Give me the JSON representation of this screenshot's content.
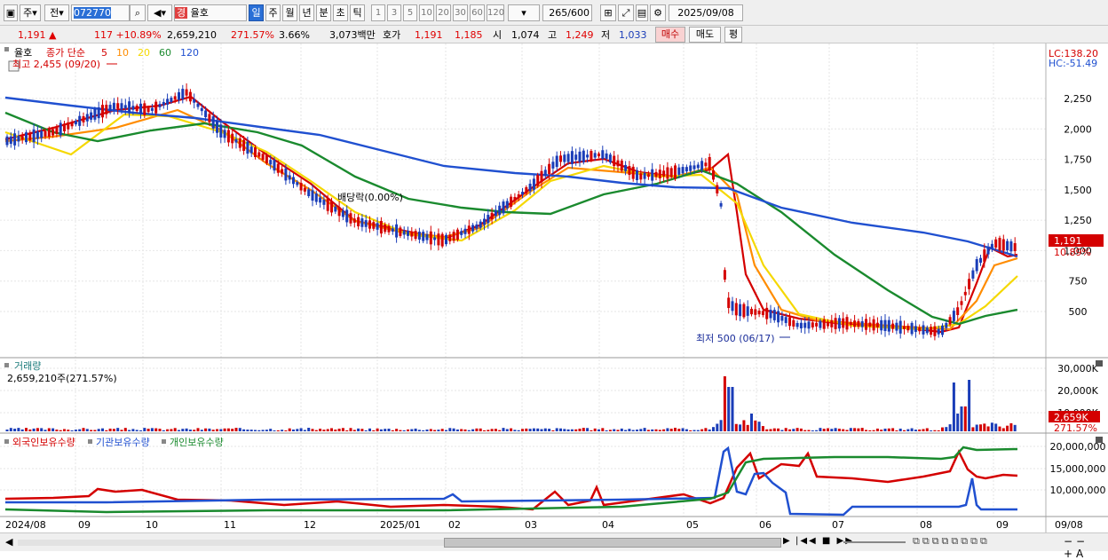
{
  "toolbar": {
    "type_label": "주",
    "prev_label": "전",
    "code": "072770",
    "stock_name_prefix": "경",
    "stock_name": "율호",
    "periods": [
      "일",
      "주",
      "월",
      "년",
      "분",
      "초",
      "틱"
    ],
    "minutes": [
      "1",
      "3",
      "5",
      "10",
      "20",
      "30",
      "60",
      "120"
    ],
    "count": "265",
    "count_total": "/600",
    "date": "2025/09/08"
  },
  "quote": {
    "price": "1,191",
    "change": "117",
    "change_pct": "+10.89%",
    "volume": "2,659,210",
    "volume_pct": "271.57%",
    "turnover_pct": "3.66%",
    "amount": "3,073백만",
    "hoga_label": "호가",
    "ask": "1,191",
    "bid": "1,185",
    "open_label": "시",
    "open": "1,074",
    "high_label": "고",
    "high": "1,249",
    "low_label": "저",
    "low": "1,033",
    "buy_label": "매수",
    "sell_label": "매도",
    "eval_label": "평"
  },
  "price_panel": {
    "stock_label": "율호",
    "ma_label": "종가 단순",
    "ma_periods": [
      "5",
      "10",
      "20",
      "60",
      "120"
    ],
    "ma_colors": [
      "#d40000",
      "#ff8c00",
      "#f5d800",
      "#1a8a2e",
      "#2050d0"
    ],
    "lc": "LC:138.20",
    "hc": "HC:-51.49",
    "high_annot": "최고 2,455 (09/20)",
    "low_annot": "최저 500 (06/17)",
    "dividend": "배당락(0.00%)",
    "yticks": [
      "2,250",
      "2,000",
      "1,750",
      "1,500",
      "1,250",
      "1,000",
      "750",
      "500"
    ],
    "last_price": "1,191",
    "last_pct": "10.89%"
  },
  "volume_panel": {
    "title": "거래량",
    "info": "2,659,210주(271.57%)",
    "yticks": [
      "30,000K",
      "20,000K",
      "10,000K"
    ],
    "last_vol": "2,659K",
    "last_pct": "271.57%"
  },
  "holding_panel": {
    "titles": [
      "외국인보유수량",
      "기관보유수량",
      "개인보유수량"
    ],
    "title_colors": [
      "#d40000",
      "#2050d0",
      "#1a8a2e"
    ],
    "yticks": [
      "20,000,000",
      "15,000,000",
      "10,000,000"
    ]
  },
  "xaxis": [
    "2024/08",
    "09",
    "10",
    "11",
    "12",
    "2025/01",
    "02",
    "03",
    "04",
    "05",
    "06",
    "07",
    "08",
    "09",
    "09/08"
  ]
}
